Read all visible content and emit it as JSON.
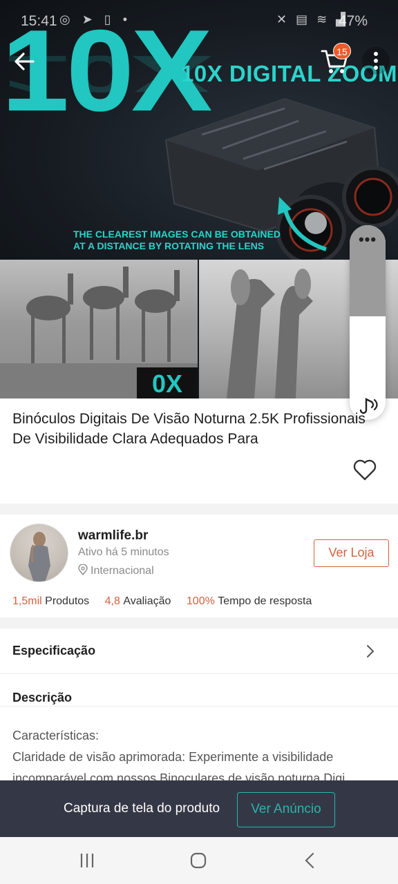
{
  "status_bar": {
    "time": "15:41",
    "battery": "47%"
  },
  "product_image": {
    "big_zoom": "10X",
    "zoom_text": "10X DIGITAL ZOOM",
    "lens_caption": "THE CLEAREST IMAGES CAN BE OBTAINED\nAT A DISTANCE BY ROTATING THE LENS",
    "zoom_tag": "0X"
  },
  "header": {
    "cart_count": "15"
  },
  "product": {
    "title": "Binóculos Digitais De Visão Noturna 2.5K Profissionais De Visibilidade Clara Adequados Para"
  },
  "shop": {
    "name": "warmlife.br",
    "active": "Ativo há 5 minutos",
    "location": "Internacional",
    "visit_button": "Ver Loja",
    "stats": [
      {
        "value": "1,5mil",
        "label": "Produtos"
      },
      {
        "value": "4,8",
        "label": "Avaliação"
      },
      {
        "value": "100%",
        "label": "Tempo de resposta"
      }
    ]
  },
  "sections": {
    "specification": "Especificação",
    "description": "Descrição"
  },
  "description": {
    "heading": "Características:",
    "line1": "Claridade de visão aprimorada: Experimente a visibilidade",
    "line2": "incomparável com nossos Binoculares de visão noturna Digi..."
  },
  "banner": {
    "text": "Captura de tela do produto",
    "button": "Ver Anúncio"
  },
  "colors": {
    "accent": "#d4603e",
    "teal": "#2ab5aa",
    "badge": "#f05a2a",
    "banner_bg": "#343846"
  }
}
